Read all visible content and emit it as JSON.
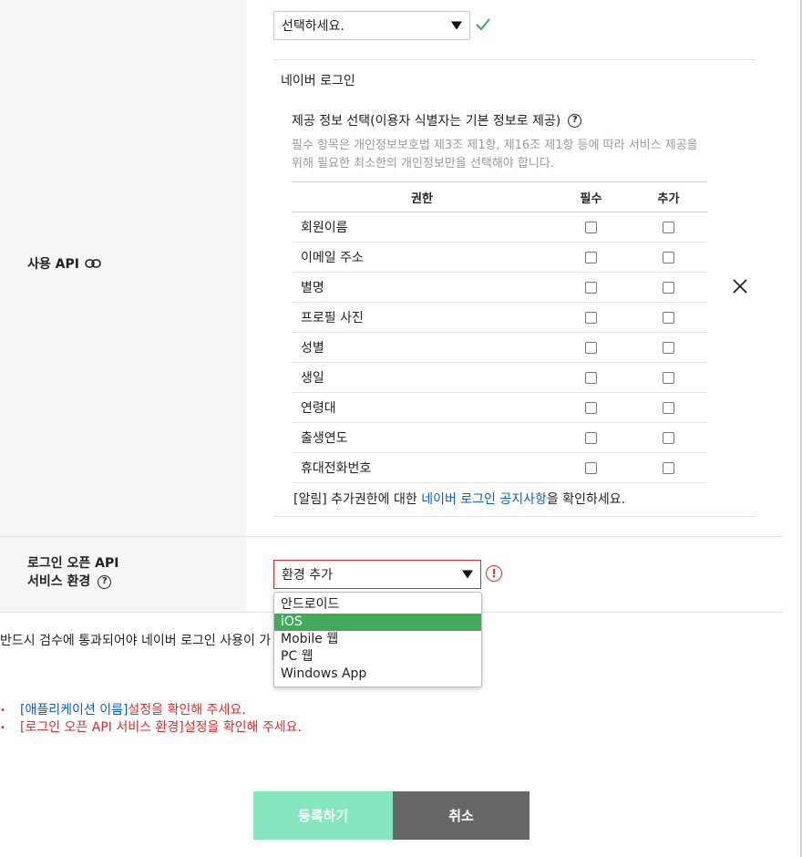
{
  "top_select": {
    "value": "선택하세요."
  },
  "api_section": {
    "label": "사용 API",
    "title": "네이버 로그인",
    "info_title": "제공 정보 선택(이용자 식별자는 기본 정보로 제공)",
    "info_desc": "필수 항목은 개인정보보호법 제3조 제1항, 제16조 제1항 등에 따라 서비스 제공을 위해 필요한 최소한의 개인정보만을 선택해야 합니다.",
    "columns": [
      "권한",
      "필수",
      "추가"
    ],
    "permissions": [
      "회원이름",
      "이메일 주소",
      "별명",
      "프로필 사진",
      "성별",
      "생일",
      "연령대",
      "출생연도",
      "휴대전화번호"
    ],
    "notice_prefix": "[알림] 추가권한에 대한 ",
    "notice_link": "네이버 로그인 공지사항",
    "notice_suffix": "을 확인하세요."
  },
  "env_section": {
    "label_line1": "로그인 오픈 API",
    "label_line2": "서비스 환경",
    "select_value": "환경 추가",
    "options": [
      "안드로이드",
      "iOS",
      "Mobile 웹",
      "PC 웹",
      "Windows App"
    ],
    "selected_option": "iOS"
  },
  "review_note": "반드시 검수에 통과되어야 네이버 로그인 사용이 가                              확인하세요.",
  "errors": [
    {
      "field": "[애플리케이션 이름]",
      "message": " 설정을 확인해 주세요.",
      "field_color": "#0b5fc6"
    },
    {
      "field": "[로그인 오픈 API 서비스 환경]",
      "message": " 설정을 확인해 주세요.",
      "field_color": "#d0302f"
    }
  ],
  "buttons": {
    "register": "등록하기",
    "cancel": "취소"
  },
  "colors": {
    "accent_green": "#43a95b",
    "error_red": "#d0302f",
    "link_blue": "#0b5fc6",
    "register_bg": "#86e6be",
    "cancel_bg": "#666666"
  }
}
